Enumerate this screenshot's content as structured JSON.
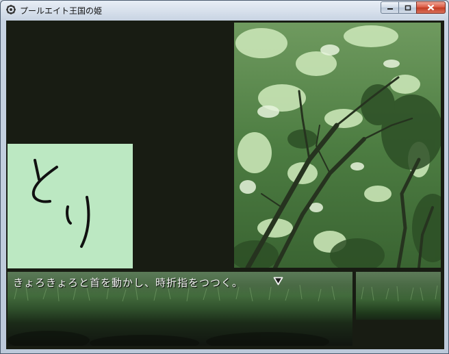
{
  "window": {
    "title": "プールエイト王国の姫",
    "icon": "gear-app-icon"
  },
  "controls": {
    "minimize_icon": "minimize-icon",
    "maximize_icon": "maximize-icon",
    "close_icon": "close-icon"
  },
  "scene": {
    "background": "forest-canopy",
    "portrait": {
      "handwriting": "とり",
      "background_color": "#bce8c2"
    }
  },
  "message": {
    "text": "きょろきょろと首を動かし、時折指をつつく。",
    "advance_icon": "next-triangle-icon"
  },
  "colors": {
    "client_background": "#181c13",
    "text": "#f2f2f2",
    "leaf_light": "#c8e6b4",
    "leaf_dark": "#2d4f26"
  }
}
